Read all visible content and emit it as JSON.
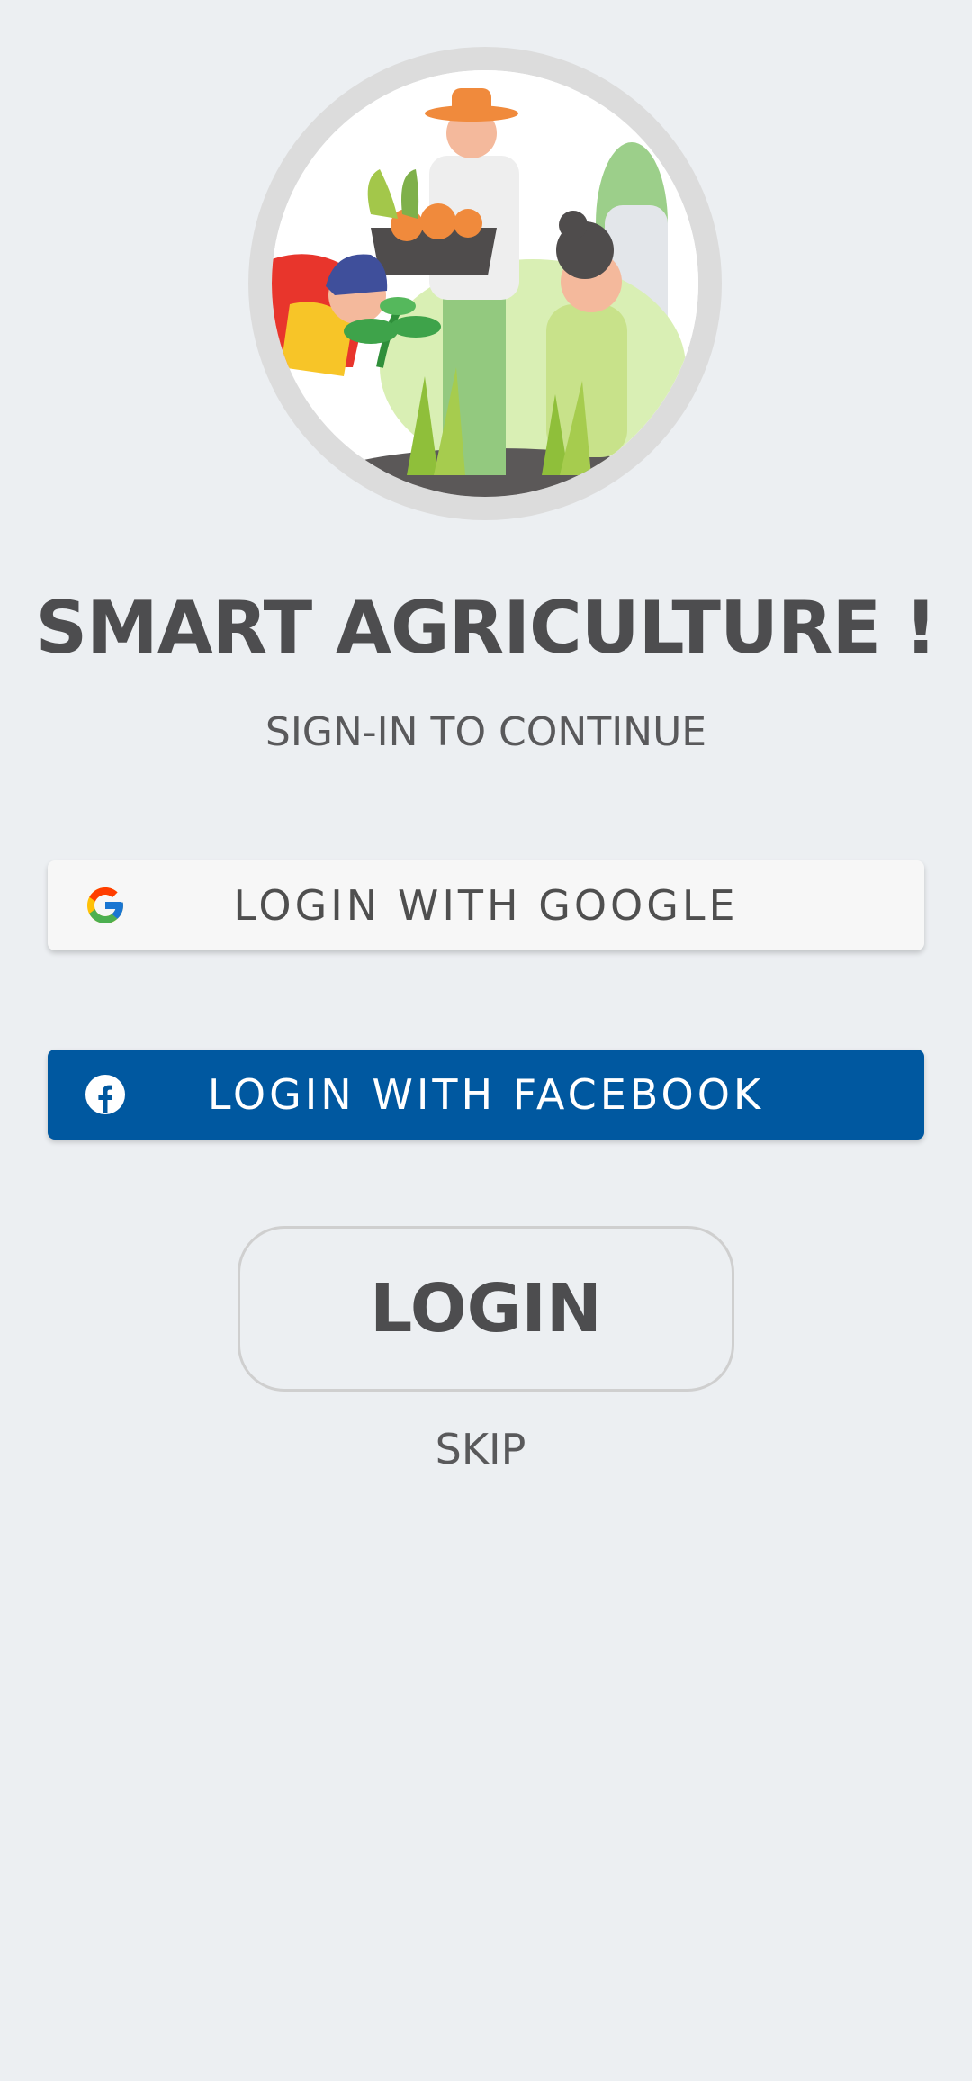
{
  "hero": {
    "image_name": "farmers-illustration"
  },
  "header": {
    "title": "SMART AGRICULTURE !",
    "subtitle": "SIGN-IN TO CONTINUE"
  },
  "auth": {
    "google": {
      "label": "LOGIN WITH GOOGLE",
      "icon": "google-icon"
    },
    "facebook": {
      "label": "LOGIN WITH FACEBOOK",
      "icon": "facebook-icon",
      "color": "#0058a0"
    },
    "login_label": "LOGIN",
    "skip_label": "SKIP"
  },
  "colors": {
    "background": "#eceff2",
    "text_dark": "#4d4d4f",
    "facebook_blue": "#0058a0"
  }
}
